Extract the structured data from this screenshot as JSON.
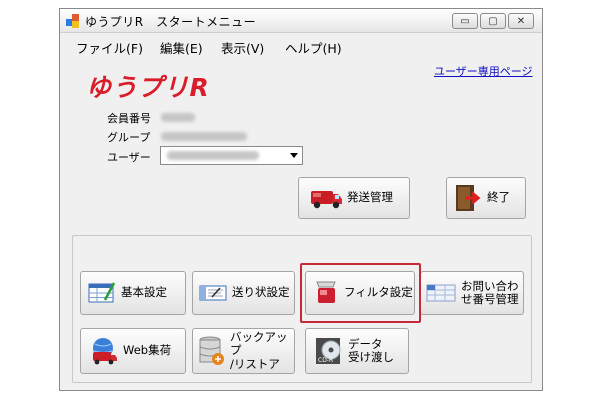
{
  "window": {
    "title": "ゆうプリR　スタートメニュー"
  },
  "titlebar_buttons": {
    "minimize": "▭",
    "maximize": "▢",
    "close": "✕"
  },
  "menu": [
    "ファイル(F)",
    "編集(E)",
    "表示(V)",
    "ヘルプ(H)"
  ],
  "user_page_link": "ユーザー専用ページ",
  "logo": "ゆうプリR",
  "info": {
    "member_no_label": "会員番号",
    "group_label": "グループ",
    "user_label": "ユーザー"
  },
  "top_buttons": {
    "shipping": "発送管理",
    "exit": "終了"
  },
  "buttons": {
    "basic": "基本設定",
    "label": "送り状設定",
    "filter": "フィルタ設定",
    "inquiry": "お問い合わ\nせ番号管理",
    "web": "Web集荷",
    "backup": "バックアップ\n/リストア",
    "data": "データ\n受け渡し"
  },
  "icon_text": {
    "cd": "CD-R"
  },
  "colors": {
    "logo": "#d81e2a",
    "highlight": "#c6293a",
    "link": "#1010c0"
  }
}
